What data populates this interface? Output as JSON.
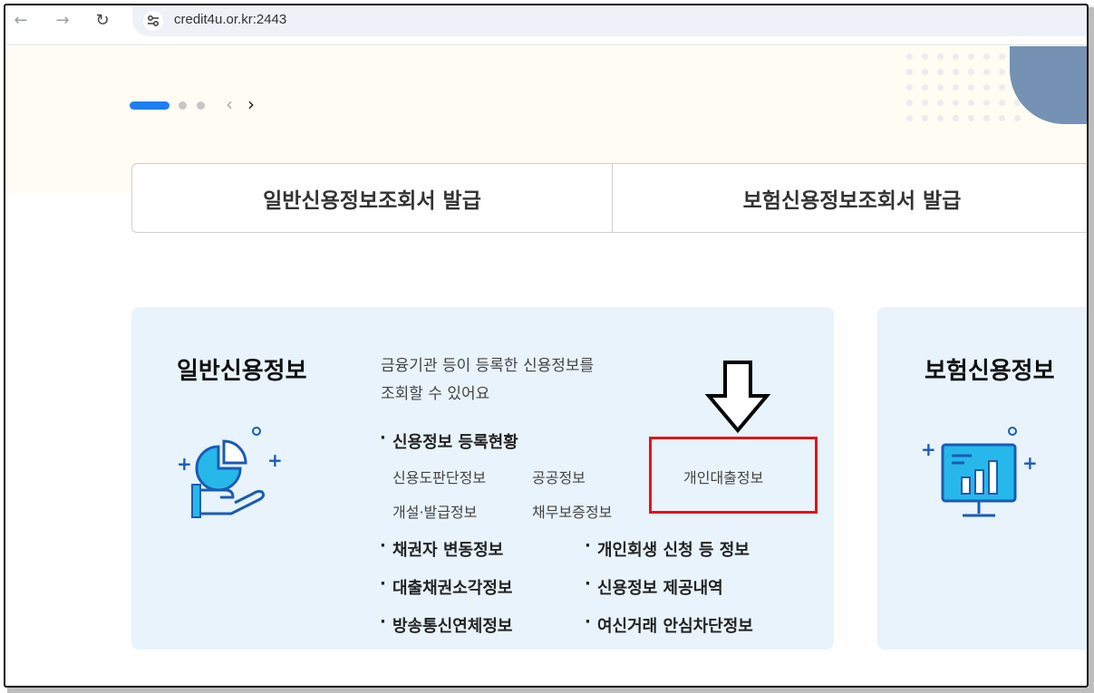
{
  "browser": {
    "url": "credit4u.or.kr:2443",
    "back_icon": "←",
    "forward_icon": "→",
    "reload_icon": "↻"
  },
  "hero": {
    "pager_prev": "‹",
    "pager_next": "›"
  },
  "issue_buttons": [
    {
      "label": "일반신용정보조회서 발급"
    },
    {
      "label": "보험신용정보조회서 발급"
    }
  ],
  "general_card": {
    "title": "일반신용정보",
    "description_line1": "금융기관 등이 등록한 신용정보를",
    "description_line2": "조회할 수 있어요",
    "registration_title": "신용정보 등록현황",
    "registration_items": [
      "신용도판단정보",
      "공공정보",
      "개인대출정보",
      "개설·발급정보",
      "채무보증정보"
    ],
    "sections_left": [
      "채권자 변동정보",
      "대출채권소각정보",
      "방송통신연체정보"
    ],
    "sections_right": [
      "개인회생 신청 등 정보",
      "신용정보 제공내역",
      "여신거래 안심차단정보"
    ]
  },
  "insurance_card": {
    "title": "보험신용정보"
  },
  "colors": {
    "accent": "#1f7ef3",
    "card_bg": "#e8f3fb",
    "highlight": "#e1141a",
    "icon_blue": "#1a5bb5",
    "icon_cyan": "#27b8ea"
  }
}
